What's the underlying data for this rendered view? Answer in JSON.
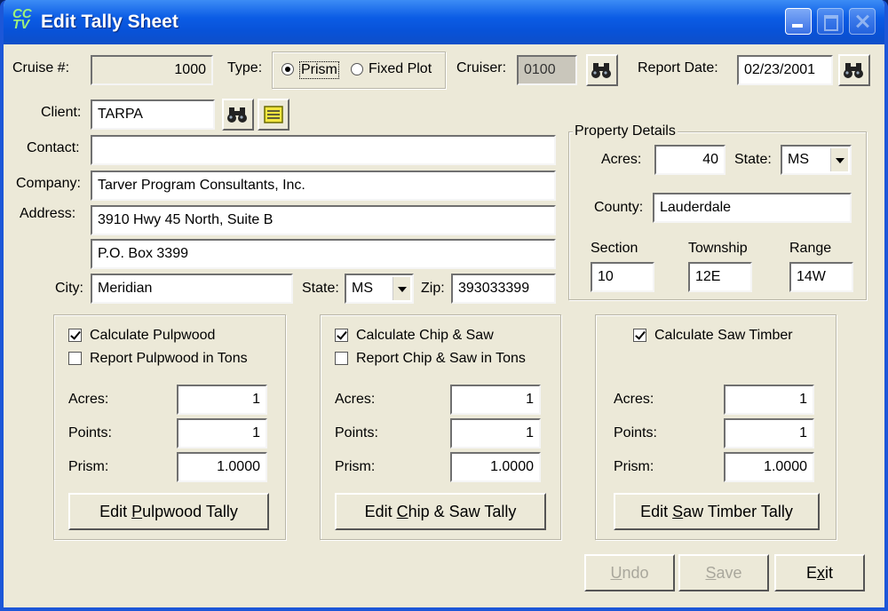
{
  "window": {
    "title": "Edit Tally Sheet",
    "app_icon_text": "CC TV"
  },
  "header": {
    "cruise_label": "Cruise #:",
    "cruise_value": "1000",
    "type_label": "Type:",
    "type_options": [
      "Prism",
      "Fixed Plot"
    ],
    "type_selected": "Prism",
    "cruiser_label": "Cruiser:",
    "cruiser_value": "0100",
    "report_date_label": "Report Date:",
    "report_date_value": "02/23/2001"
  },
  "client": {
    "client_label": "Client:",
    "client_value": "TARPA",
    "contact_label": "Contact:",
    "contact_value": "",
    "company_label": "Company:",
    "company_value": "Tarver Program Consultants, Inc.",
    "address_label": "Address:",
    "address1_value": "3910 Hwy 45 North, Suite B",
    "address2_value": "P.O. Box 3399",
    "city_label": "City:",
    "city_value": "Meridian",
    "state_label": "State:",
    "state_value": "MS",
    "zip_label": "Zip:",
    "zip_value": "393033399"
  },
  "property": {
    "title": "Property Details",
    "acres_label": "Acres:",
    "acres_value": "40",
    "state_label": "State:",
    "state_value": "MS",
    "county_label": "County:",
    "county_value": "Lauderdale",
    "section_label": "Section",
    "section_value": "10",
    "township_label": "Township",
    "township_value": "12E",
    "range_label": "Range",
    "range_value": "14W"
  },
  "pulpwood": {
    "calc_label": "Calculate Pulpwood",
    "calc_checked": true,
    "tons_label": "Report Pulpwood in Tons",
    "tons_checked": false,
    "acres_label": "Acres:",
    "acres_value": "1",
    "points_label": "Points:",
    "points_value": "1",
    "prism_label": "Prism:",
    "prism_value": "1.0000",
    "button_pre": "Edit ",
    "button_key": "P",
    "button_post": "ulpwood Tally"
  },
  "chipsaw": {
    "calc_label": "Calculate Chip & Saw",
    "calc_checked": true,
    "tons_label": "Report Chip & Saw in Tons",
    "tons_checked": false,
    "acres_label": "Acres:",
    "acres_value": "1",
    "points_label": "Points:",
    "points_value": "1",
    "prism_label": "Prism:",
    "prism_value": "1.0000",
    "button_pre": "Edit ",
    "button_key": "C",
    "button_post": "hip & Saw Tally"
  },
  "sawtimber": {
    "calc_label": "Calculate Saw Timber",
    "calc_checked": true,
    "acres_label": "Acres:",
    "acres_value": "1",
    "points_label": "Points:",
    "points_value": "1",
    "prism_label": "Prism:",
    "prism_value": "1.0000",
    "button_pre": "Edit ",
    "button_key": "S",
    "button_post": "aw Timber Tally"
  },
  "footer": {
    "undo_key": "U",
    "undo_rest": "ndo",
    "save_key": "S",
    "save_rest": "ave",
    "exit_pre": "E",
    "exit_key": "x",
    "exit_post": "it"
  }
}
